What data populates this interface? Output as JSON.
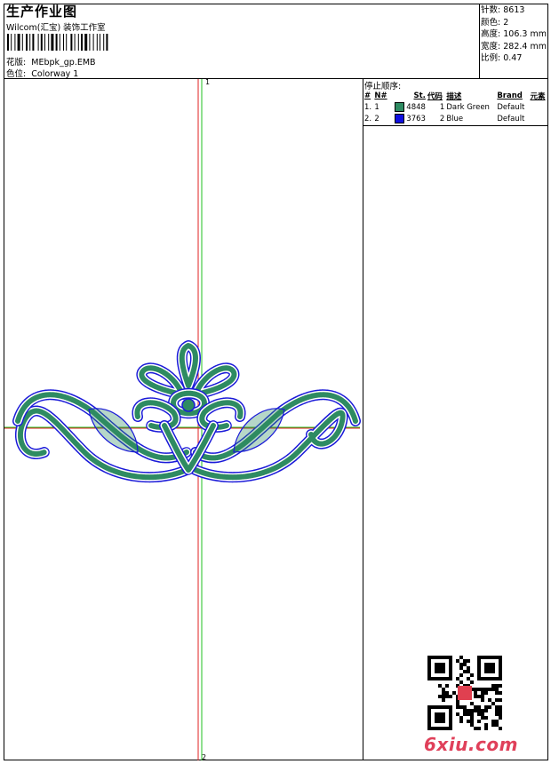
{
  "header": {
    "title": "生产作业图",
    "company": "Wilcom(汇宝) 装饰工作室",
    "design_label": "花版:",
    "design_value": "MEbpk_gp.EMB",
    "colorway_label": "色位:",
    "colorway_value": "Colorway 1"
  },
  "stats": [
    {
      "label": "针数:",
      "value": "8613"
    },
    {
      "label": "颜色:",
      "value": "2"
    },
    {
      "label": "高度:",
      "value": "106.3 mm"
    },
    {
      "label": "宽度:",
      "value": "282.4 mm"
    },
    {
      "label": "比例:",
      "value": "0.47"
    }
  ],
  "stop_sequence": {
    "heading": "停止顺序:",
    "columns": [
      "#",
      "N#",
      "St.",
      "代码",
      "描述",
      "Brand",
      "元素"
    ],
    "rows": [
      {
        "idx": "1.",
        "n": "1",
        "color": "#2e8b62",
        "st": "4848",
        "code": "1",
        "desc": "Dark Green",
        "brand": "Default",
        "elem": ""
      },
      {
        "idx": "2.",
        "n": "2",
        "color": "#1010e0",
        "st": "3763",
        "code": "2",
        "desc": "Blue",
        "brand": "Default",
        "elem": ""
      }
    ]
  },
  "axis": {
    "label_top": "1",
    "label_bottom": "2"
  },
  "colors": {
    "fill_green": "#2e8b62",
    "outline_blue": "#1a1ad8",
    "axis_red": "#e02020",
    "axis_green": "#20c020"
  },
  "watermark": "6xiu.com",
  "icons": [
    "qr-code-icon"
  ]
}
